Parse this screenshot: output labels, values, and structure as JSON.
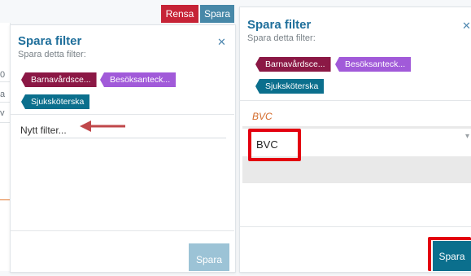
{
  "toolbar": {
    "rensa_label": "Rensa",
    "spara_label": "Spara"
  },
  "dialog_left": {
    "title": "Spara filter",
    "subtitle": "Spara detta filter:",
    "tags": [
      {
        "label": "Barnavårdsce..."
      },
      {
        "label": "Besöksanteck..."
      },
      {
        "label": "Sjuksköterska"
      }
    ],
    "name_value": "",
    "name_placeholder": "Nytt filter...",
    "save_label": "Spara"
  },
  "dialog_right": {
    "title": "Spara filter",
    "subtitle": "Spara detta filter:",
    "tags": [
      {
        "label": "Barnavårdsce..."
      },
      {
        "label": "Besöksanteck..."
      },
      {
        "label": "Sjuksköterska"
      }
    ],
    "filter_label": "BVC",
    "filter_value": "BVC",
    "save_label": "Spara"
  },
  "background": {
    "fragments": [
      "0",
      "a",
      "v"
    ]
  },
  "icons": {
    "close": "close-icon",
    "arrow": "arrow-annotation-icon"
  },
  "colors": {
    "accent_blue": "#1f6f9b",
    "save_button_disabled": "#9cc3d6",
    "save_button_active": "#0b6f8d",
    "rensa": "#c62336",
    "highlight_red": "#e3000f"
  }
}
